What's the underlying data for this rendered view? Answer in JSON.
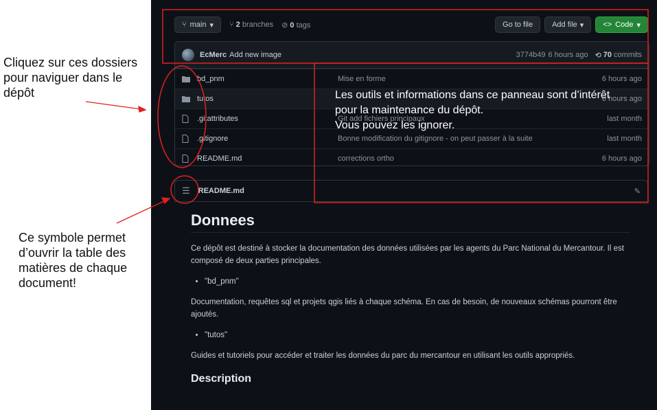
{
  "annotations": {
    "left_top": "Cliquez sur ces dossiers pour naviguer dans le dépôt",
    "left_bottom": "Ce symbole permet d’ouvrir la table des matières de chaque document!",
    "overlay": "Les outils et informations dans ce panneau sont d’intérêt pour la maintenance du dépôt.\nVous pouvez les ignorer."
  },
  "toolbar": {
    "branch": "main",
    "branches_count": "2",
    "branches_label": "branches",
    "tags_count": "0",
    "tags_label": "tags",
    "go_to_file": "Go to file",
    "add_file": "Add file",
    "code": "Code"
  },
  "commit": {
    "author": "EcMerc",
    "message": "Add new image",
    "hash": "3774b49",
    "time": "6 hours ago",
    "commits_count": "70",
    "commits_label": "commits"
  },
  "files": [
    {
      "type": "folder",
      "name": "bd_pnm",
      "message": "Mise en forme",
      "time": "6 hours ago"
    },
    {
      "type": "folder",
      "name": "tutos",
      "message": "",
      "time": "6 hours ago"
    },
    {
      "type": "file",
      "name": ".gitattributes",
      "message": "Git add fichiers principaux",
      "time": "last month"
    },
    {
      "type": "file",
      "name": ".gitignore",
      "message": "Bonne modification du gitignore - on peut passer à la suite",
      "time": "last month"
    },
    {
      "type": "file",
      "name": "README.md",
      "message": "corrections ortho",
      "time": "6 hours ago"
    }
  ],
  "readme": {
    "filename": "README.md",
    "h1": "Donnees",
    "p1": "Ce dépôt est destiné à stocker la documentation des données utilisées par les agents du Parc National du Mercantour. Il est composé de deux parties principales.",
    "bullet1": "\"bd_pnm\"",
    "p2": "Documentation, requêtes sql et projets qgis liés à chaque schéma. En cas de besoin, de nouveaux schémas pourront être ajoutés.",
    "bullet2": "\"tutos\"",
    "p3": "Guides et tutoriels pour accéder et traiter les données du parc du mercantour en utilisant les outils appropriés.",
    "h2": "Description"
  },
  "colors": {
    "highlight_red": "#e0211f",
    "green_button": "#238636",
    "background": "#0d1117"
  }
}
